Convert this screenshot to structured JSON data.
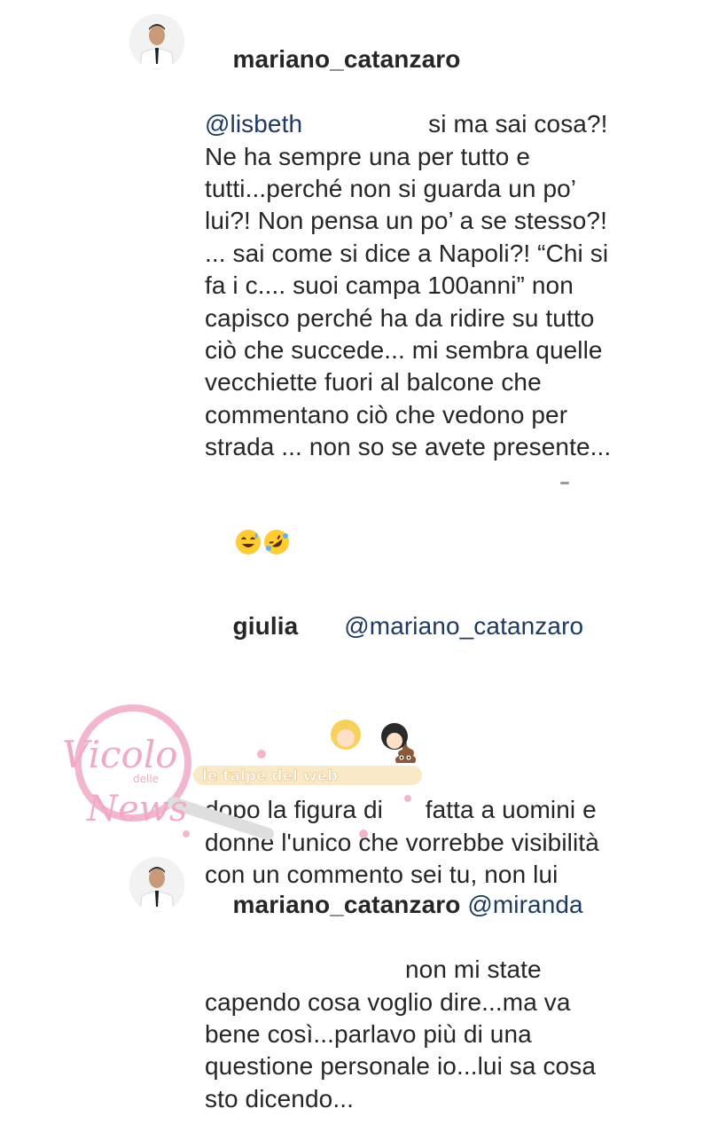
{
  "comments": [
    {
      "username": "mariano_catanzaro",
      "mention": "@lisbeth",
      "body": "si ma sai cosa?! Ne ha sempre una per tutto e tutti...perché non si guarda un po’ lui?! Non pensa un po’ a se stesso?! ... sai come si dice a Napoli?! “Chi si fa i c.... suoi campa 100anni” non capisco perché ha da ridire su tutto ciò che succede... mi sembra quelle vecchiette fuori al balcone che commentano ciò che vedono per strada ... non so se avete presente...",
      "emojis": [
        "grinning-sweat-emoji",
        "rolling-on-floor-laughing-emoji"
      ]
    },
    {
      "username": "giulia",
      "mention": "@mariano_catanzaro",
      "body_before_emoji": "dopo la figura di",
      "emoji": "poop-emoji",
      "body_after_emoji": "fatta a uomini e donne l'unico che vorrebbe visibilità con un commento sei tu, non lui"
    },
    {
      "username": "mariano_catanzaro",
      "mention": "@miranda",
      "body": "non mi state capendo cosa voglio dire...ma va bene così...parlavo più di una questione personale io...lui sa cosa sto dicendo..."
    }
  ],
  "watermark": {
    "brand_text": "Vicolo delle News",
    "tagline": "le talpe del web"
  },
  "colors": {
    "text": "#262626",
    "mention": "#1e3a60",
    "watermark_pink": "#f0a9c6",
    "watermark_ribbon": "#f7d9a5"
  }
}
